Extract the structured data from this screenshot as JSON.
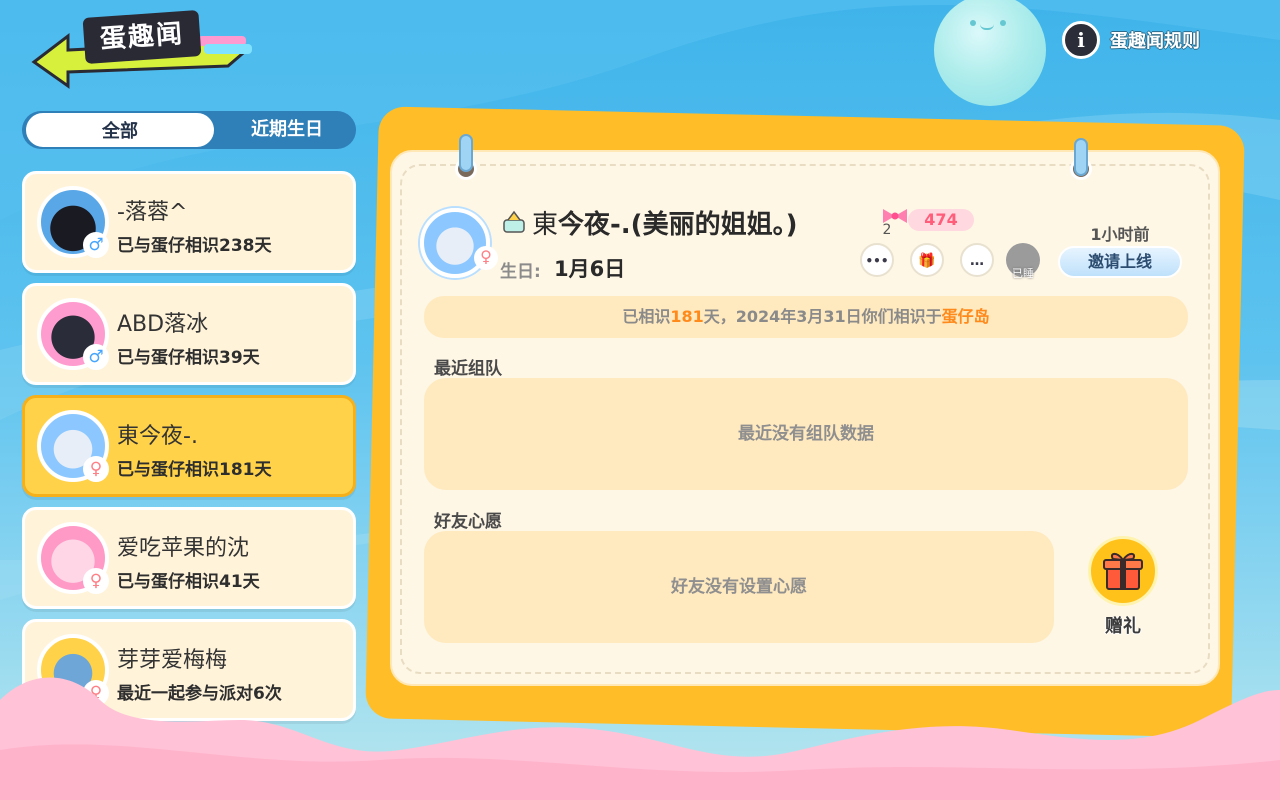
{
  "header": {
    "title": "蛋趣闻",
    "rules_label": "蛋趣闻规则",
    "rules_icon": "info-icon"
  },
  "tabs": [
    {
      "label": "全部",
      "active": true
    },
    {
      "label": "近期生日",
      "active": false
    }
  ],
  "friends": [
    {
      "name": "-落蓉^",
      "subtitle": "已与蛋仔相识238天",
      "gender": "male",
      "gender_symbol": "♂",
      "selected": false,
      "avatar_colors": [
        "#5aa7e8",
        "#1a1a22"
      ]
    },
    {
      "name": "ABD落冰",
      "subtitle": "已与蛋仔相识39天",
      "gender": "male",
      "gender_symbol": "♂",
      "selected": false,
      "avatar_colors": [
        "#ff9ccf",
        "#2a2c3a"
      ]
    },
    {
      "name": "東今夜-.",
      "subtitle": "已与蛋仔相识181天",
      "gender": "female",
      "gender_symbol": "♀",
      "selected": true,
      "avatar_colors": [
        "#8cc8ff",
        "#e7eef8"
      ]
    },
    {
      "name": "爱吃苹果的沈",
      "subtitle": "已与蛋仔相识41天",
      "gender": "female",
      "gender_symbol": "♀",
      "selected": false,
      "avatar_colors": [
        "#ff9ac7",
        "#ffd6e6"
      ]
    },
    {
      "name": "芽芽爱梅梅",
      "subtitle": "最近一起参与派对6次",
      "gender": "female",
      "gender_symbol": "♀",
      "selected": false,
      "avatar_colors": [
        "#ffd24a",
        "#6ea6d8"
      ]
    }
  ],
  "profile": {
    "name_prefix": "東",
    "name": "今夜-.(美丽的姐姐。)",
    "gender_symbol": "♀",
    "birthday_label": "生日:",
    "birthday_value": "1月6日",
    "bow_count": "2",
    "intimacy": "474",
    "last_online": "1小时前",
    "invite_label": "邀请上线",
    "offline_label": "已睡",
    "actions": [
      {
        "name": "more-button",
        "icon": "more-icon",
        "glyph": "•••"
      },
      {
        "name": "gift-small-button",
        "icon": "gift-icon",
        "glyph": "🎁"
      },
      {
        "name": "chat-button",
        "icon": "chat-bubble-icon",
        "glyph": "…"
      }
    ]
  },
  "met_info": {
    "prefix": "已相识",
    "days": "181",
    "middle": "天，2024年3月31日你们相识于",
    "place": "蛋仔岛"
  },
  "recent_team": {
    "title": "最近组队",
    "empty_text": "最近没有组队数据"
  },
  "wishes": {
    "title": "好友心愿",
    "empty_text": "好友没有设置心愿"
  },
  "gift_button": {
    "label": "赠礼",
    "icon": "gift-box-icon"
  },
  "colors": {
    "sky": "#3fb4ea",
    "card_frame": "#ffbd27",
    "selected_item": "#ffd24a",
    "highlight": "#ff8a1c"
  }
}
